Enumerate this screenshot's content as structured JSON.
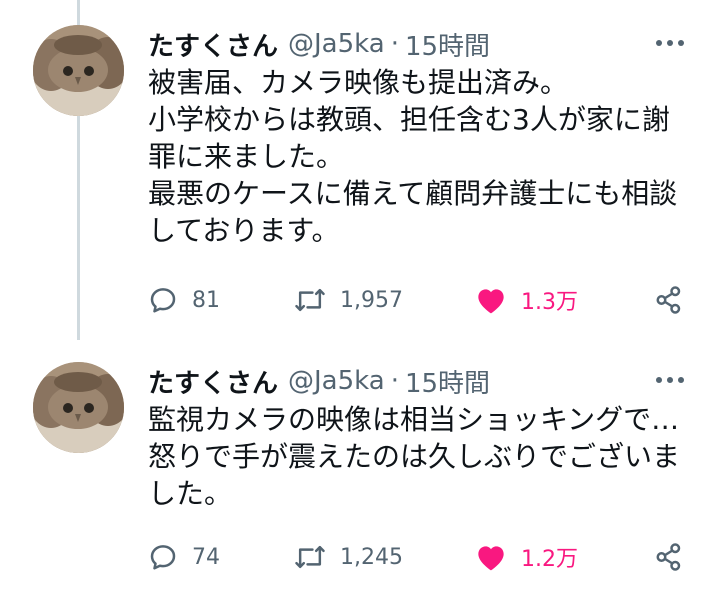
{
  "colors": {
    "text": "#0f1419",
    "secondary": "#536471",
    "like": "#f91880",
    "thread_line": "#cfd9de"
  },
  "icons": {
    "reply": "speech-bubble-outline",
    "retweet": "retweet-arrows",
    "like": "heart-filled",
    "share": "share-nodes",
    "more": "three-dots-horizontal"
  },
  "tweets": [
    {
      "display_name": "たすくさん",
      "handle": "@Ja5ka",
      "separator": "·",
      "time": "15時間",
      "lines": [
        "被害届、カメラ映像も提出済み。",
        "小学校からは教頭、担任含む3人が家に謝",
        "罪に来ました。",
        "最悪のケースに備えて顧問弁護士にも相談",
        "しております。"
      ],
      "replies": "81",
      "retweets": "1,957",
      "likes": "1.3万"
    },
    {
      "display_name": "たすくさん",
      "handle": "@Ja5ka",
      "separator": "·",
      "time": "15時間",
      "lines": [
        "監視カメラの映像は相当ショッキングで…",
        "怒りで手が震えたのは久しぶりでございま",
        "した。"
      ],
      "replies": "74",
      "retweets": "1,245",
      "likes": "1.2万"
    }
  ]
}
